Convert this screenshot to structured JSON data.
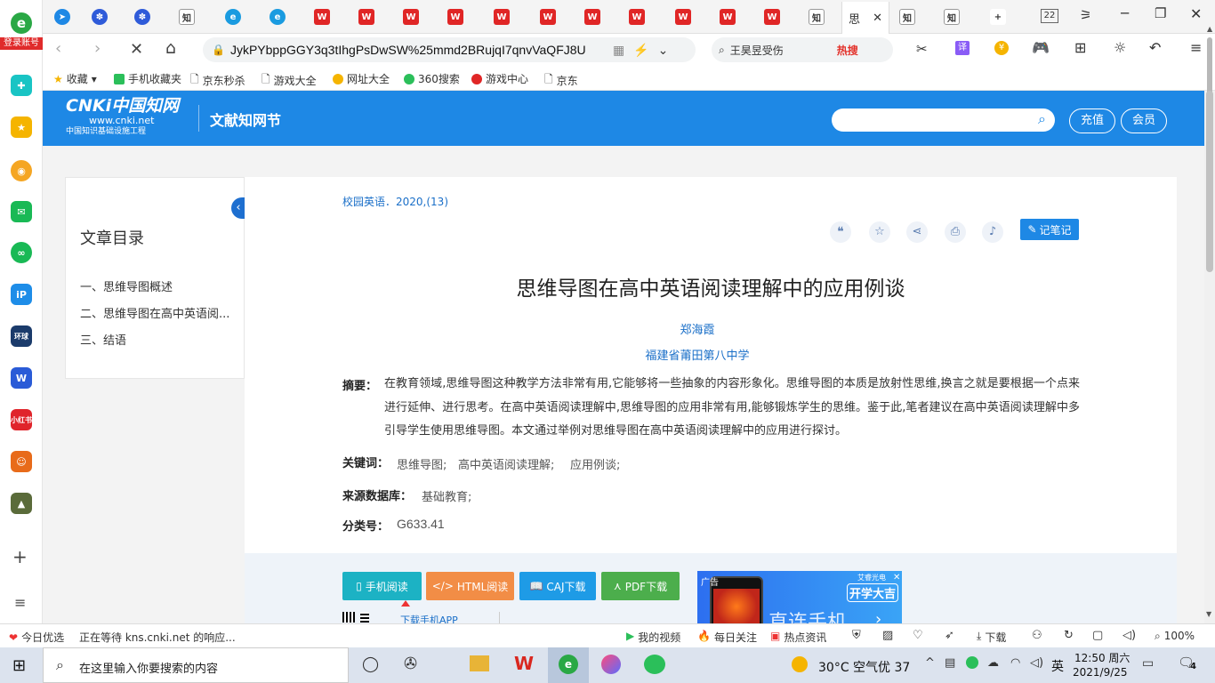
{
  "left_rail": {
    "login_label": "登录账号"
  },
  "tabs": {
    "active_title": "思",
    "counter": "22"
  },
  "nav": {
    "url": "JykPYbppGGY3q3tIhgPsDwSW%25mmd2BRujqI7qnvVaQFJ8U",
    "search_text": "王昊昱受伤",
    "hot_label": "热搜",
    "translate_label": "译"
  },
  "bookmarks": [
    {
      "label": "收藏"
    },
    {
      "label": "手机收藏夹"
    },
    {
      "label": "京东秒杀"
    },
    {
      "label": "游戏大全"
    },
    {
      "label": "网址大全"
    },
    {
      "label": "360搜索"
    },
    {
      "label": "游戏中心"
    },
    {
      "label": "京东"
    }
  ],
  "cnki": {
    "logo_text": "CNKi中国知网",
    "logo_url": "www.cnki.net",
    "logo_sub": "中国知识基础设施工程",
    "section": "文献知网节",
    "recharge": "充值",
    "member": "会员"
  },
  "toc": {
    "title": "文章目录",
    "items": [
      "一、思维导图概述",
      "二、思维导图在高中英语阅...",
      "三、结语"
    ]
  },
  "article": {
    "source": "校园英语",
    "issue": "．2020,(13)",
    "note_button": "记笔记",
    "title": "思维导图在高中英语阅读理解中的应用例谈",
    "author": "郑海霞",
    "institution": "福建省莆田第八中学",
    "abstract_label": "摘要：",
    "abstract": "在教育领域,思维导图这种教学方法非常有用,它能够将一些抽象的内容形象化。思维导图的本质是放射性思维,换言之就是要根据一个点来进行延伸、进行思考。在高中英语阅读理解中,思维导图的应用非常有用,能够锻炼学生的思维。鉴于此,笔者建议在高中英语阅读理解中多引导学生使用思维导图。本文通过举例对思维导图在高中英语阅读理解中的应用进行探讨。",
    "keywords_label": "关键词：",
    "keywords": [
      "思维导图;",
      "高中英语阅读理解;",
      "应用例谈;"
    ],
    "database_label": "来源数据库：",
    "database": "基础教育;",
    "class_label": "分类号：",
    "class_code": "G633.41",
    "buttons": {
      "mobile": "手机阅读",
      "html": "HTML阅读",
      "caj": "CAJ下载",
      "pdf": "PDF下载"
    },
    "app_download": "下载手机APP",
    "ad_label": "广告",
    "ad_brand": "艾睿光电",
    "ad_headline": "开学大吉",
    "ad_text": "直连手机"
  },
  "status": {
    "left1": "今日优选",
    "loading": "正在等待 kns.cnki.net 的响应...",
    "video": "我的视频",
    "daily": "每日关注",
    "news": "热点资讯",
    "download": "下载",
    "zoom": "100%"
  },
  "taskbar": {
    "search_placeholder": "在这里输入你要搜索的内容",
    "weather": "30°C  空气优 37",
    "ime": "英",
    "time": "12:50 周六",
    "date": "2021/9/25",
    "notify_count": "4"
  },
  "colors": {
    "cnki_blue": "#1e88e5",
    "link_blue": "#1a6fc8",
    "mobile_btn": "#1cb2c4",
    "html_btn": "#f28d46",
    "caj_btn": "#1e9be6",
    "pdf_btn": "#4cae4c"
  }
}
